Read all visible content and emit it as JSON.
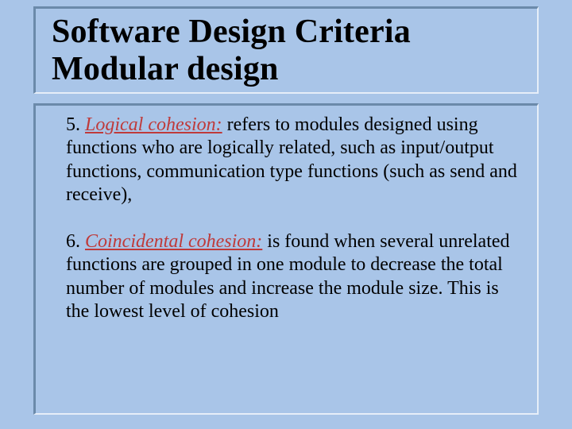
{
  "title": {
    "line1": "Software Design Criteria",
    "line2": "Modular design"
  },
  "items": [
    {
      "num": "5.",
      "term": "Logical cohesion:",
      "text": " refers to modules designed using functions who are logically related, such as input/output functions, communication type functions (such as send and receive),"
    },
    {
      "num": "6.",
      "term": "Coincidental cohesion:",
      "text": " is found when several unrelated functions are grouped in one module to decrease the total number of modules and increase the module size. This is the lowest level of cohesion"
    }
  ]
}
